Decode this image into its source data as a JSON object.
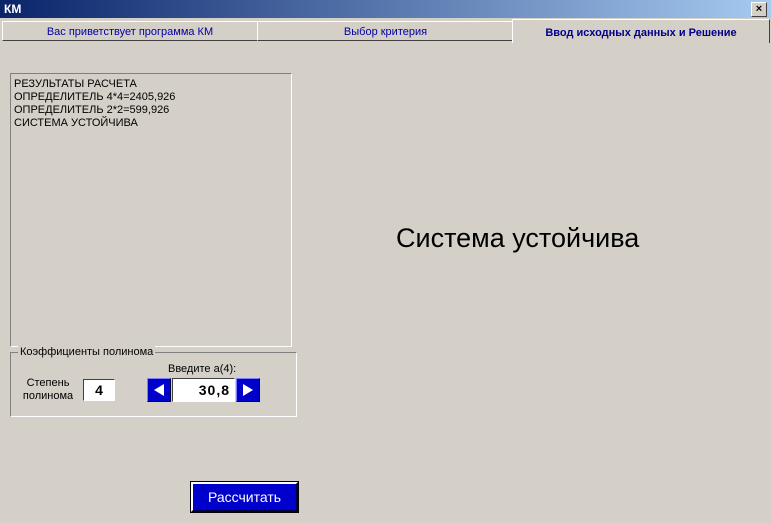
{
  "window": {
    "title": "КМ",
    "close_glyph": "×"
  },
  "tabs": [
    {
      "label": "Вас приветствует программа КМ"
    },
    {
      "label": "Выбор критерия"
    },
    {
      "label": "Ввод исходных данных и Решение"
    }
  ],
  "results": {
    "lines": [
      "РЕЗУЛЬТАТЫ РАСЧЕТА",
      "ОПРЕДЕЛИТЕЛЬ 4*4=2405,926",
      "ОПРЕДЕЛИТЕЛЬ 2*2=599,926",
      "СИСТЕМА УСТОЙЧИВА"
    ]
  },
  "status_message": "Система устойчива",
  "coefficients": {
    "group_title": "Коэффициенты полинома",
    "degree_label_line1": "Степень",
    "degree_label_line2": "полинома",
    "degree_value": "4",
    "enter_label": "Введите а(4):",
    "coef_value": "30,8"
  },
  "calculate_button": "Рассчитать",
  "colors": {
    "accent_blue": "#0000cc",
    "background": "#d4d0c8"
  }
}
